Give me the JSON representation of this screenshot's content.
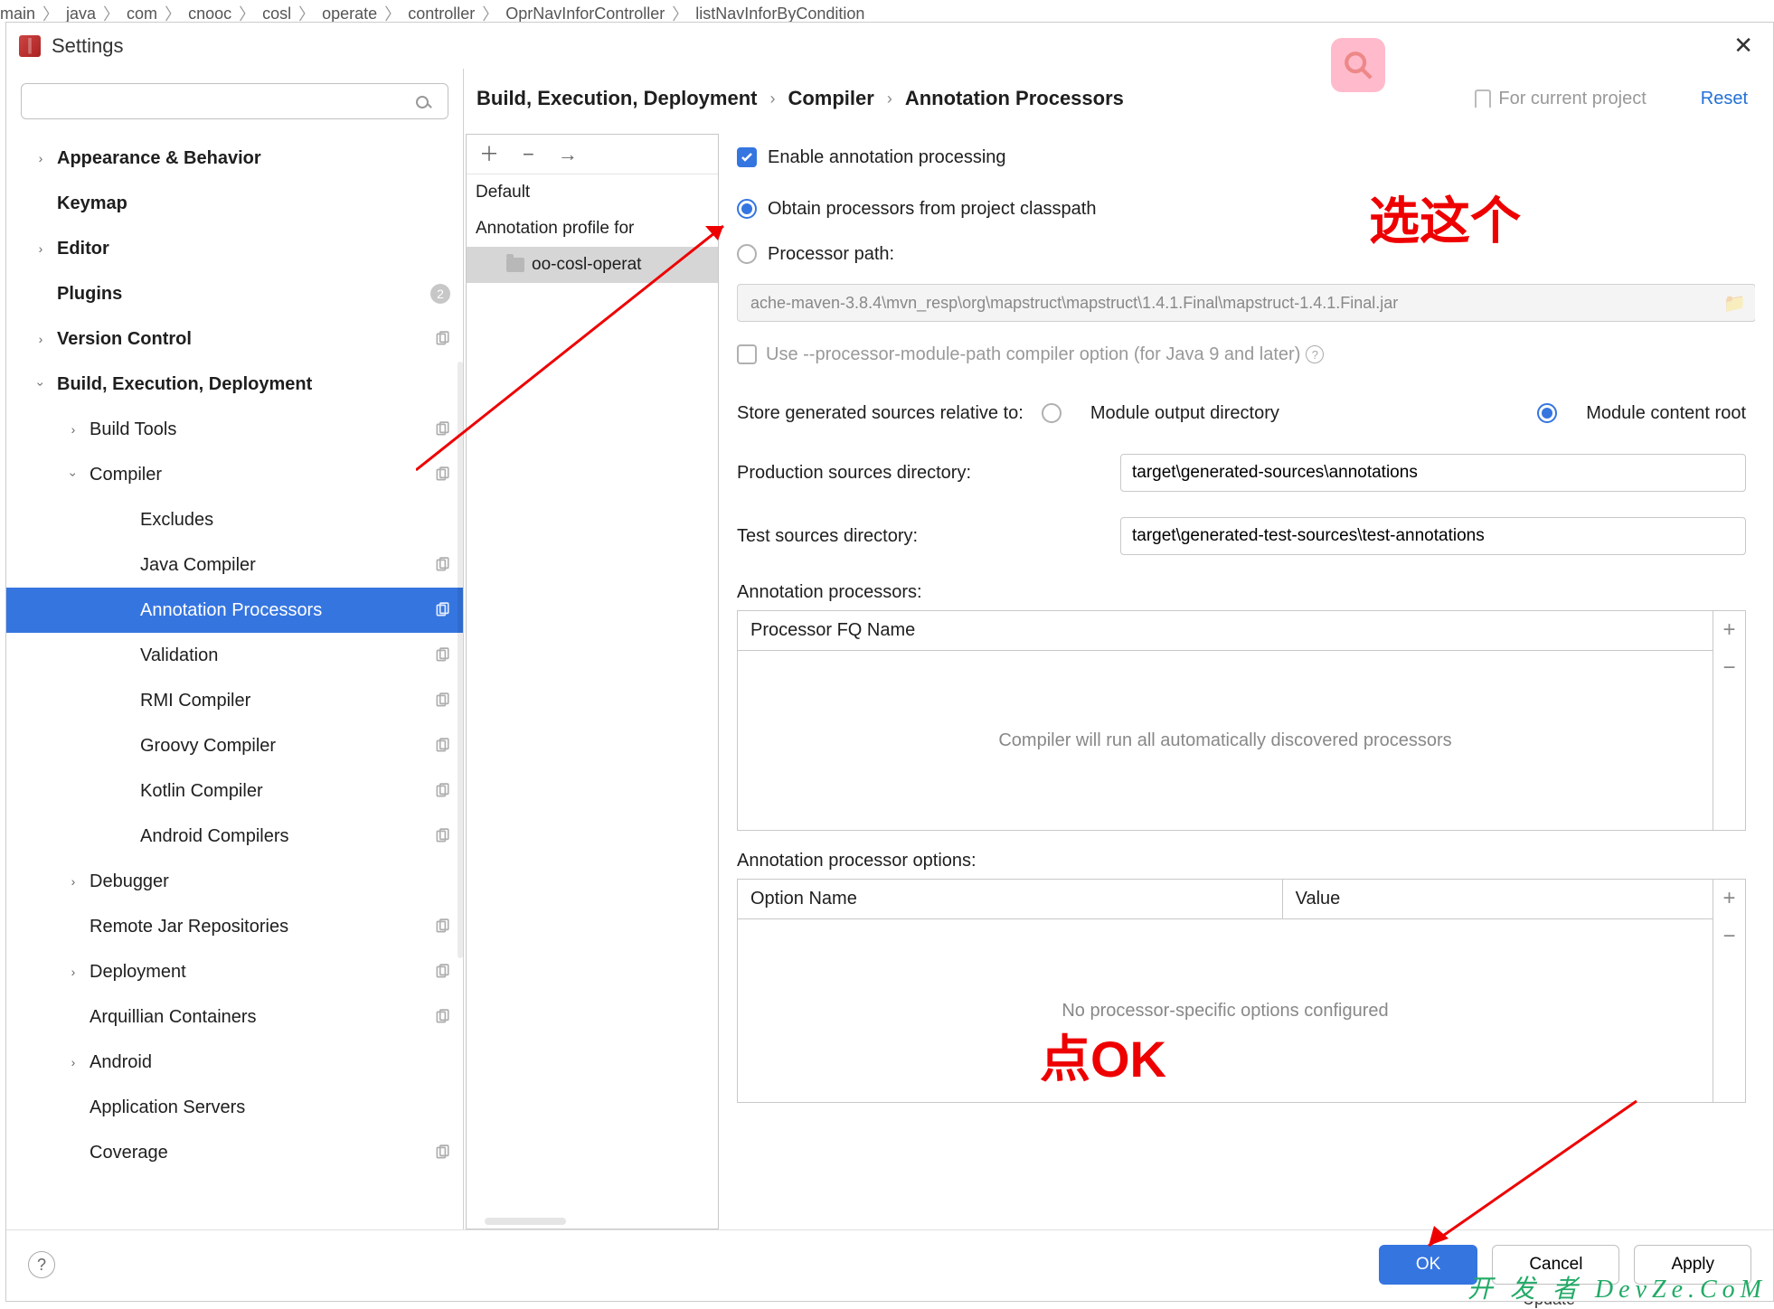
{
  "bg_breadcrumb": [
    "main",
    "java",
    "com",
    "cnooc",
    "cosl",
    "operate",
    "controller",
    "OprNavInforController",
    "listNavInforByCondition"
  ],
  "bg_update": "Update",
  "window": {
    "title": "Settings"
  },
  "search_placeholder": "",
  "tree": [
    {
      "label": "Appearance & Behavior",
      "lvl": 0,
      "chev": "right",
      "bold": true
    },
    {
      "label": "Keymap",
      "lvl": 0,
      "chev": "",
      "bold": true
    },
    {
      "label": "Editor",
      "lvl": 0,
      "chev": "right",
      "bold": true
    },
    {
      "label": "Plugins",
      "lvl": 0,
      "chev": "",
      "bold": true,
      "badge": "2"
    },
    {
      "label": "Version Control",
      "lvl": 0,
      "chev": "right",
      "bold": true,
      "copy": true
    },
    {
      "label": "Build, Execution, Deployment",
      "lvl": 0,
      "chev": "down",
      "bold": true
    },
    {
      "label": "Build Tools",
      "lvl": 1,
      "chev": "right",
      "copy": true
    },
    {
      "label": "Compiler",
      "lvl": 1,
      "chev": "down",
      "copy": true
    },
    {
      "label": "Excludes",
      "lvl": 2
    },
    {
      "label": "Java Compiler",
      "lvl": 2,
      "copy": true
    },
    {
      "label": "Annotation Processors",
      "lvl": 2,
      "selected": true,
      "copy": true
    },
    {
      "label": "Validation",
      "lvl": 2,
      "copy": true
    },
    {
      "label": "RMI Compiler",
      "lvl": 2,
      "copy": true
    },
    {
      "label": "Groovy Compiler",
      "lvl": 2,
      "copy": true
    },
    {
      "label": "Kotlin Compiler",
      "lvl": 2,
      "copy": true
    },
    {
      "label": "Android Compilers",
      "lvl": 2,
      "copy": true
    },
    {
      "label": "Debugger",
      "lvl": 1,
      "chev": "right"
    },
    {
      "label": "Remote Jar Repositories",
      "lvl": 1,
      "copy": true
    },
    {
      "label": "Deployment",
      "lvl": 1,
      "chev": "right",
      "copy": true
    },
    {
      "label": "Arquillian Containers",
      "lvl": 1,
      "copy": true
    },
    {
      "label": "Android",
      "lvl": 1,
      "chev": "right"
    },
    {
      "label": "Application Servers",
      "lvl": 1
    },
    {
      "label": "Coverage",
      "lvl": 1,
      "copy": true
    }
  ],
  "breadcrumb": [
    "Build, Execution, Deployment",
    "Compiler",
    "Annotation Processors"
  ],
  "for_project": "For current project",
  "reset": "Reset",
  "profiles": {
    "default": "Default",
    "profile": "Annotation profile for",
    "module": "oo-cosl-operat"
  },
  "settings": {
    "enable": "Enable annotation processing",
    "obtain_classpath": "Obtain processors from project classpath",
    "processor_path_label": "Processor path:",
    "processor_path_value": "ache-maven-3.8.4\\mvn_resp\\org\\mapstruct\\mapstruct\\1.4.1.Final\\mapstruct-1.4.1.Final.jar",
    "module_path_option": "Use --processor-module-path compiler option (for Java 9 and later)",
    "store_label": "Store generated sources relative to:",
    "module_output": "Module output directory",
    "module_content": "Module content root",
    "prod_dir_label": "Production sources directory:",
    "prod_dir_value": "target\\generated-sources\\annotations",
    "test_dir_label": "Test sources directory:",
    "test_dir_value": "target\\generated-test-sources\\test-annotations",
    "ann_proc_label": "Annotation processors:",
    "proc_fq_header": "Processor FQ Name",
    "proc_placeholder": "Compiler will run all automatically discovered processors",
    "opt_label": "Annotation processor options:",
    "opt_name": "Option Name",
    "opt_value": "Value",
    "opt_placeholder": "No processor-specific options configured"
  },
  "footer": {
    "ok": "OK",
    "cancel": "Cancel",
    "apply": "Apply"
  },
  "annotations": {
    "a1": "选这个",
    "a2": "点OK"
  },
  "watermark": "开 发 者  DevZe.CoM"
}
